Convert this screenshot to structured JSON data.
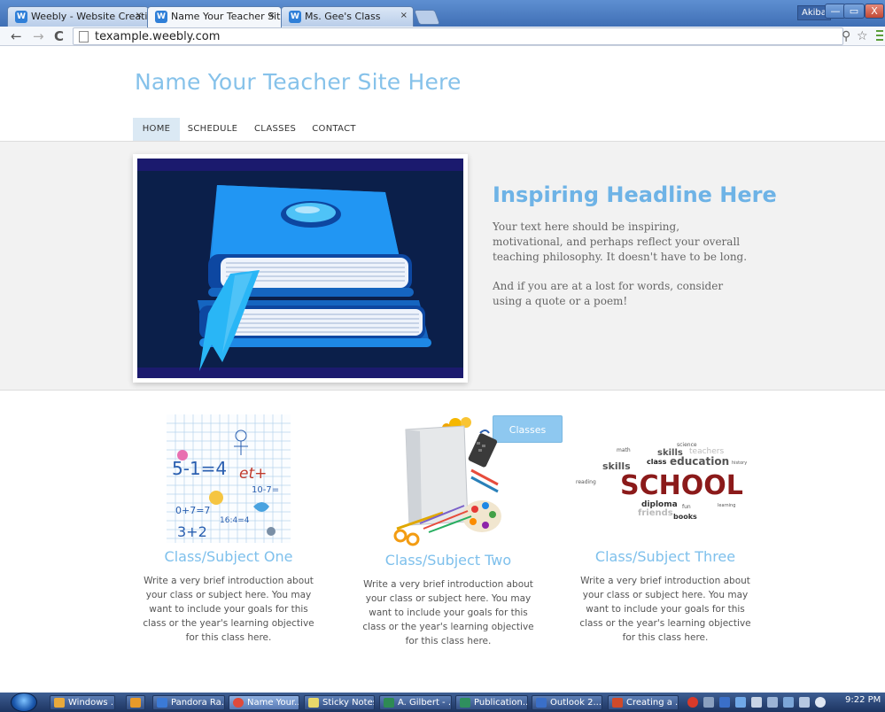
{
  "browser": {
    "tabs": [
      {
        "label": "Weebly - Website Creatio",
        "close": "×"
      },
      {
        "label": "Name Your Teacher Site H",
        "close": "×"
      },
      {
        "label": "Ms. Gee's Class",
        "close": "×"
      }
    ],
    "user_label": "Akiba",
    "window_controls": {
      "minimize": "—",
      "maximize": "▭",
      "close": "X"
    },
    "address": "texample.weebly.com",
    "nav": {
      "back": "←",
      "forward": "→",
      "reload": "C"
    },
    "icons": [
      "key-icon",
      "star-icon",
      "menu-icon"
    ]
  },
  "site": {
    "title": "Name Your Teacher Site Here",
    "nav": [
      {
        "label": "HOME",
        "active": true
      },
      {
        "label": "SCHEDULE",
        "active": false
      },
      {
        "label": "CLASSES",
        "active": false
      },
      {
        "label": "CONTACT",
        "active": false
      }
    ],
    "banner": {
      "headline": "Inspiring Headline Here",
      "paragraph1": "Your text here should be inspiring, motivational, and perhaps reflect your overall teaching philosophy. It doesn't have to be long.",
      "paragraph2": "And if you are at a lost for words, consider using a quote or a poem!",
      "button": "Classes"
    },
    "columns": [
      {
        "title": "Class/Subject One",
        "text": "Write a very brief introduction about your class or subject here. You may want to include your goals for this class or the year's learning objective for this class here."
      },
      {
        "title": "Class/Subject Two",
        "text": "Write a very brief introduction about your class or subject here. You may want to include your goals for this class or the year's learning objective for this class here."
      },
      {
        "title": "Class/Subject Three",
        "text": "Write a very brief introduction about your class or subject here. You may want to include your goals for this class or the year's learning objective for this class here."
      }
    ],
    "word_cloud": {
      "main": "SCHOOL",
      "words": [
        "education",
        "diploma",
        "friends",
        "books",
        "skills",
        "class",
        "fun",
        "teachers",
        "learning",
        "reading",
        "math",
        "history",
        "science"
      ]
    },
    "math_drawing": {
      "texts": [
        "5-1=4",
        "et+",
        "0+7=7",
        "3+2",
        "16:4=4",
        "10-7="
      ]
    }
  },
  "taskbar": {
    "items": [
      {
        "label": "Windows ...",
        "color": "#e8a93c"
      },
      {
        "label": "",
        "color": "#e89a2a"
      },
      {
        "label": "Pandora Ra...",
        "color": "#3b7ad6"
      },
      {
        "label": "Name Your...",
        "color": "#e04a3a"
      },
      {
        "label": "Sticky Notes",
        "color": "#e8d86a"
      },
      {
        "label": "A. Gilbert - ...",
        "color": "#2e8a54"
      },
      {
        "label": "Publication...",
        "color": "#2f8f5e"
      },
      {
        "label": "Outlook 2...",
        "color": "#3a6fc8"
      },
      {
        "label": "Creating a ...",
        "color": "#d04a2a"
      }
    ],
    "clock": "9:22 PM"
  }
}
